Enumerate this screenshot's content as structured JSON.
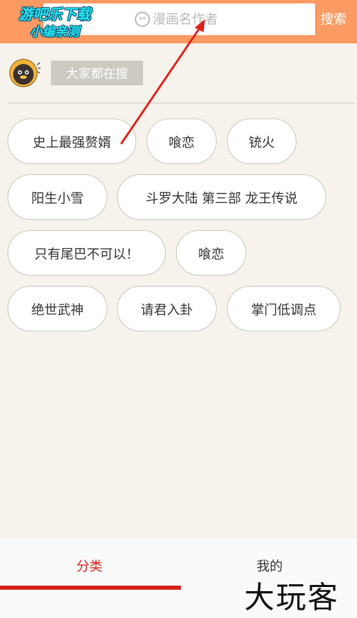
{
  "header": {
    "search_placeholder": "漫画名作者",
    "search_button": "搜索"
  },
  "watermark": {
    "line1": "游吧乐下载",
    "line2": "小编亲测"
  },
  "section": {
    "label": "大家都在搜"
  },
  "tags": [
    "史上最强赘婿",
    "喰恋",
    "铳火",
    "阳生小雪",
    "斗罗大陆 第三部 龙王传说",
    "只有尾巴不可以！",
    "喰恋",
    "绝世武神",
    "请君入卦",
    "掌门低调点"
  ],
  "bottom_nav": {
    "tab_category": "分类",
    "tab_mine": "我的"
  },
  "brand": "大玩客",
  "colors": {
    "header": "#fb9a63",
    "accent": "#d2231c",
    "background": "#f5f3ec"
  },
  "icons": [
    "search-icon",
    "mascot-icon"
  ]
}
